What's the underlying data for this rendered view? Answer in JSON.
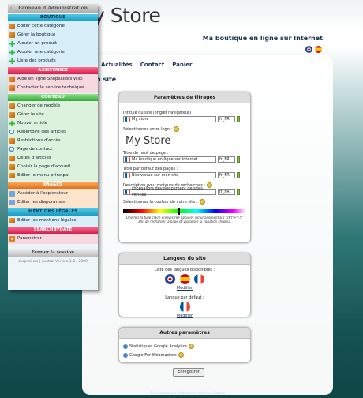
{
  "header": {
    "store_logo": "y Store",
    "shop_title": "Ma boutique en ligne sur Internet",
    "languages": [
      "en-flag",
      "es-flag"
    ]
  },
  "topnav": [
    "Actualités",
    "Contact",
    "Panier"
  ],
  "page_heading": "n site",
  "settings_panel": {
    "title": "Paramètres de titrages",
    "site_name_label": "Intitulé du site (onglet navigateur) :",
    "site_name_value": "My store",
    "lang_code": "fr_FR",
    "logo_label": "Sélectionnez votre logo :",
    "logo_preview": "My Store",
    "page_header_label": "Titre de haut de page :",
    "page_header_value": "Ma boutique en ligne sur Internet",
    "default_title_label": "Titre par défaut des pages :",
    "default_title_value": "Bienvenue sur mon site",
    "seo_desc_label": "Description pour moteurs de recherches :",
    "seo_desc_value": "shopsailors developpement de sites vitrines",
    "color_label": "Sélectionnez la couleur de votre site :",
    "color_note": "Une fois la tuile claire enregistrée appuyer simultanément sur \"ctrl\"+\"F5\" afin de recharger la page et visualiser la variation chroma."
  },
  "languages_panel": {
    "title": "Langues du site",
    "available_label": "Liste des langues disponibles :",
    "modify": "Modifier",
    "default_label": "Langue par défaut :",
    "modify2": "Modifier"
  },
  "other_panel": {
    "title": "Autres paramètres",
    "item1": "Statistiques Google Analytics",
    "item2": "Google For Webmasters"
  },
  "save_label": "Enregistrer",
  "footer": "Site hébergé par Shopsailors · Mentions légales",
  "sidebar": {
    "title": "Panneau d'Administration",
    "sections": [
      {
        "title": "BOUTIQUE",
        "color": "blue",
        "items": [
          {
            "label": "Editer cette catégorie",
            "icon": "pencil-icon"
          },
          {
            "label": "Gérer la boutique",
            "icon": "pencil-icon"
          },
          {
            "label": "Ajouter un produit",
            "icon": "plus-icon"
          },
          {
            "label": "Ajouter une catégorie",
            "icon": "plus-icon"
          },
          {
            "label": "Liste des produits",
            "icon": "plus-icon"
          }
        ]
      },
      {
        "title": "ASSISTANCE",
        "color": "red",
        "items": [
          {
            "label": "Aide en ligne Shopsailors Wiki",
            "icon": "pencil-icon"
          },
          {
            "label": "Contacter le service technique",
            "icon": "pencil-icon"
          }
        ]
      },
      {
        "title": "CONTENU",
        "color": "green",
        "items": [
          {
            "label": "Changer de modèle",
            "icon": "pencil-icon"
          },
          {
            "label": "Gérer le site",
            "icon": "pencil-icon"
          },
          {
            "label": "Nouvel article",
            "icon": "plus-icon"
          },
          {
            "label": "Répertoire des articles",
            "icon": "search-icon"
          },
          {
            "label": "Restrictions d'accès",
            "icon": "pencil-icon"
          },
          {
            "label": "Page de contact",
            "icon": "search-icon"
          },
          {
            "label": "Listes d'articles",
            "icon": "pencil-icon"
          },
          {
            "label": "Choisir la page d'accueil",
            "icon": "pencil-icon"
          },
          {
            "label": "Editer le menu principal",
            "icon": "pencil-icon"
          }
        ]
      },
      {
        "title": "IMAGES",
        "color": "orange",
        "items": [
          {
            "label": "Accéder à l'explorateur",
            "icon": "grid-icon"
          },
          {
            "label": "Editer les diaporamas",
            "icon": "grid-icon"
          }
        ]
      },
      {
        "title": "MENTIONS LÉGALES",
        "color": "blue",
        "items": [
          {
            "label": "Editer les mentions légales",
            "icon": "pencil-icon"
          }
        ]
      },
      {
        "title": "SEARCHBYDATE",
        "color": "red",
        "items": [
          {
            "label": "Paramètrer",
            "icon": "gear-icon"
          }
        ]
      }
    ],
    "close_label": "Fermer la session",
    "version": "shopsailors | Austral Version 1.0 / 2009"
  }
}
